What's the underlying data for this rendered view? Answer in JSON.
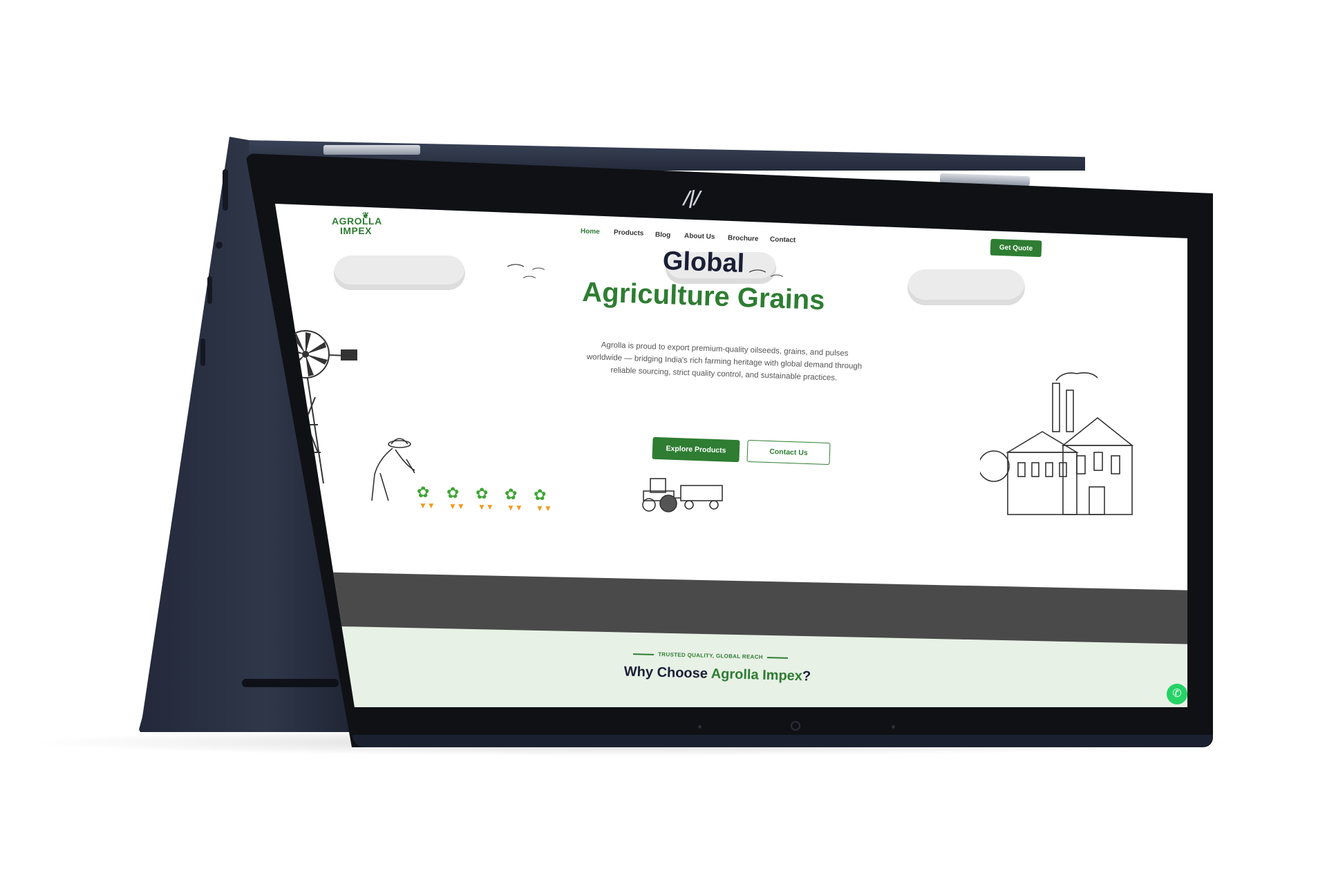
{
  "site": {
    "logo_line1": "AGROLLA",
    "logo_line2": "IMPEX",
    "nav": [
      {
        "label": "Home",
        "active": true
      },
      {
        "label": "Products",
        "active": false
      },
      {
        "label": "Blog",
        "active": false
      },
      {
        "label": "About Us",
        "active": false
      },
      {
        "label": "Brochure",
        "active": false
      },
      {
        "label": "Contact",
        "active": false
      }
    ],
    "cta_label": "Get Quote"
  },
  "hero": {
    "title_line1": "Global",
    "title_line2": "Agriculture Grains",
    "description": "Agrolla is proud to export premium-quality oilseeds, grains, and pulses worldwide — bridging India's rich farming heritage with global demand through reliable sourcing, strict quality control, and sustainable practices.",
    "primary_button": "Explore Products",
    "secondary_button": "Contact Us"
  },
  "section": {
    "eyebrow": "TRUSTED QUALITY, GLOBAL REACH",
    "heading_prefix": "Why Choose ",
    "heading_accent": "Agrolla Impex",
    "heading_suffix": "?"
  },
  "colors": {
    "brand_green": "#2e7d32",
    "heading_navy": "#1a1f36",
    "device_body": "#252b3b",
    "whatsapp_green": "#25d366"
  },
  "icons": {
    "device_brand": "hp-logo-icon",
    "chat": "whatsapp-icon"
  }
}
